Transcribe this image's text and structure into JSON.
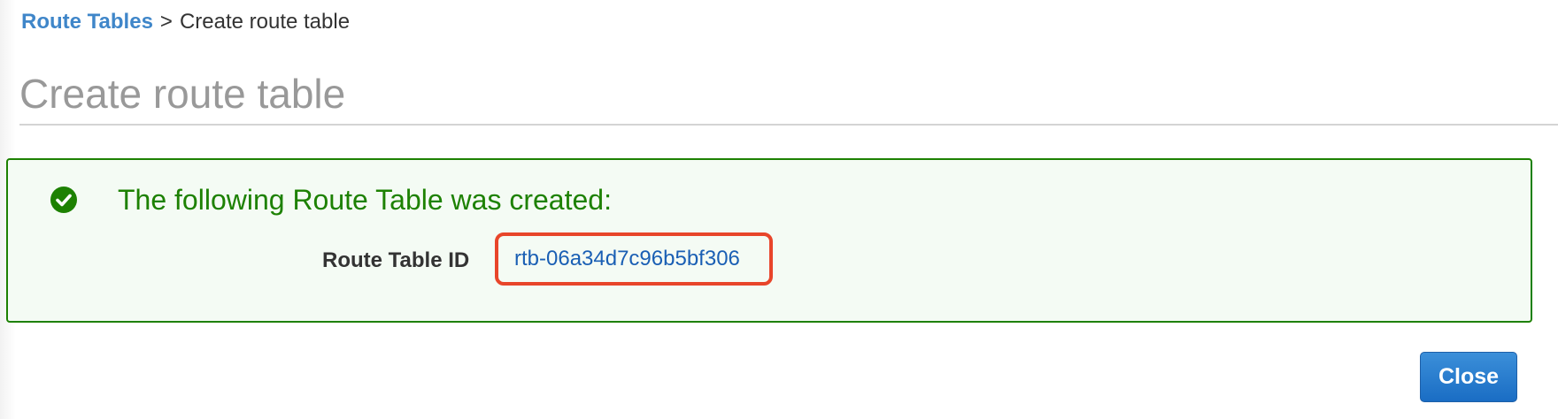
{
  "breadcrumb": {
    "parent": "Route Tables",
    "separator": ">",
    "current": "Create route table"
  },
  "page": {
    "title": "Create route table"
  },
  "alert": {
    "type": "success",
    "icon": "check-circle-icon",
    "message": "The following Route Table was created:",
    "field_label": "Route Table ID",
    "field_value": "rtb-06a34d7c96b5bf306"
  },
  "actions": {
    "close_label": "Close"
  },
  "colors": {
    "success": "#1d8102",
    "link": "#3f86c9",
    "primary_button": "#1a6dc4",
    "highlight_box": "#e8452a"
  }
}
